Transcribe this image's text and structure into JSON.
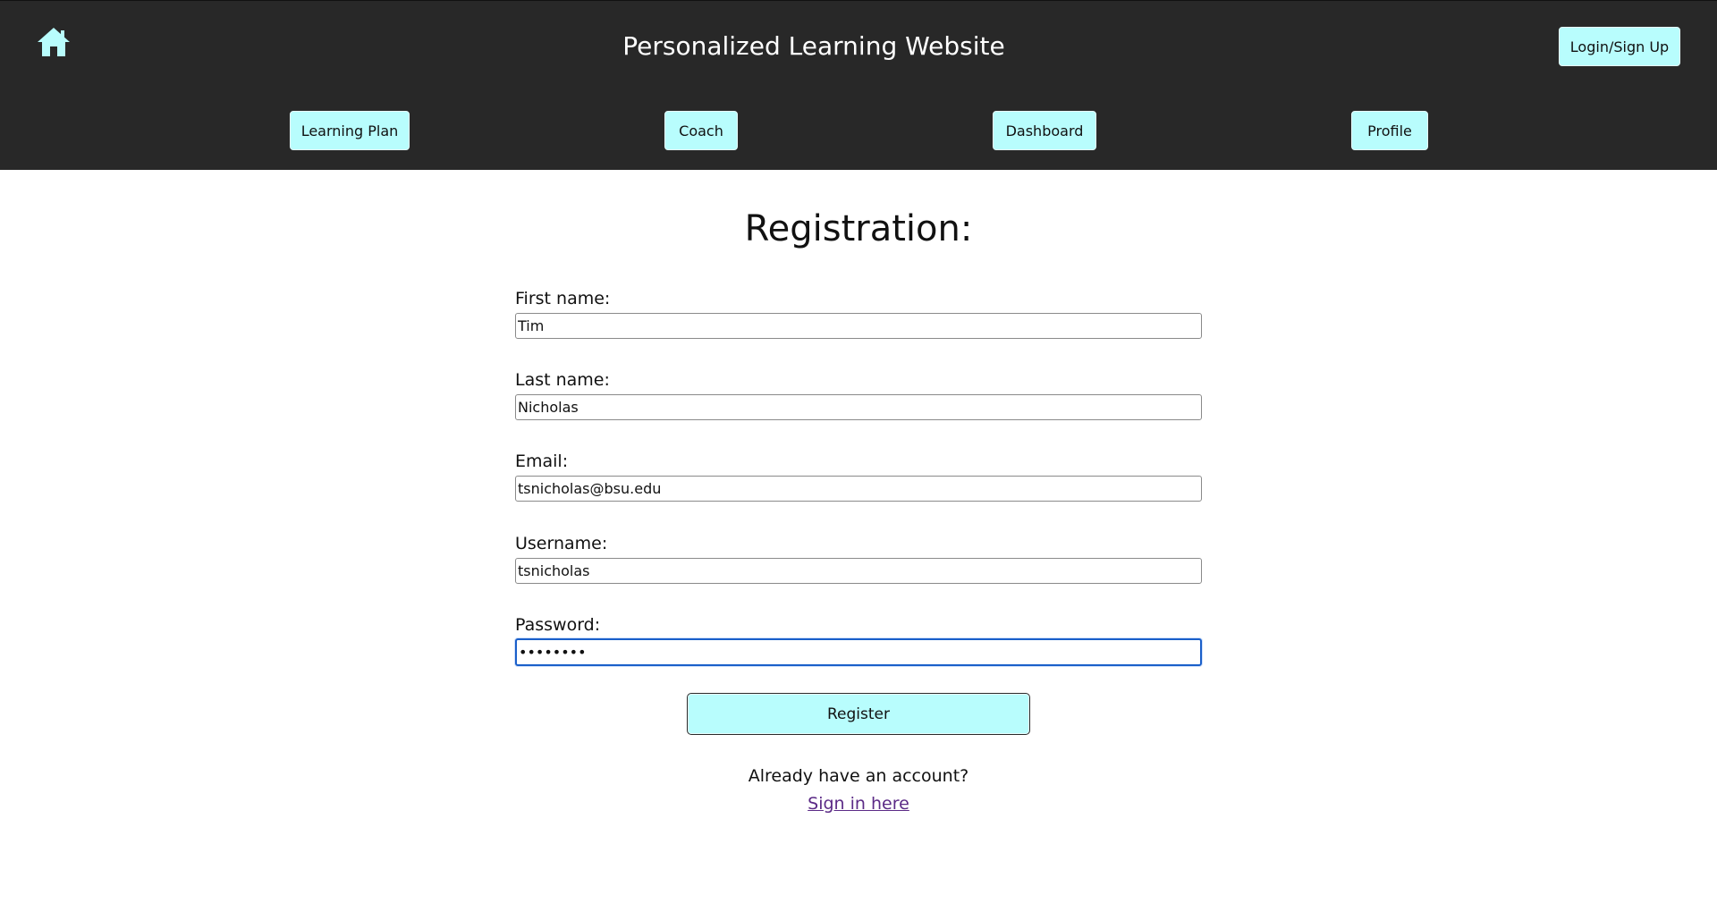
{
  "header": {
    "title": "Personalized Learning Website",
    "home_icon": "home-icon",
    "login_label": "Login/Sign Up",
    "nav": [
      {
        "label": "Learning Plan"
      },
      {
        "label": "Coach"
      },
      {
        "label": "Dashboard"
      },
      {
        "label": "Profile"
      }
    ]
  },
  "form": {
    "title": "Registration:",
    "fields": [
      {
        "label": "First name:",
        "value": "Tim"
      },
      {
        "label": "Last name:",
        "value": "Nicholas"
      },
      {
        "label": "Email:",
        "value": "tsnicholas@bsu.edu"
      },
      {
        "label": "Username:",
        "value": "tsnicholas"
      },
      {
        "label": "Password:",
        "value": "password"
      }
    ],
    "register_label": "Register",
    "already_text": "Already have an account?",
    "signin_link": "Sign in here"
  },
  "colors": {
    "header_bg": "#282828",
    "button_bg": "#b8fdfd",
    "home_icon": "#b8fdfd",
    "link": "#5b2a86",
    "focus": "#1a5fc9"
  }
}
